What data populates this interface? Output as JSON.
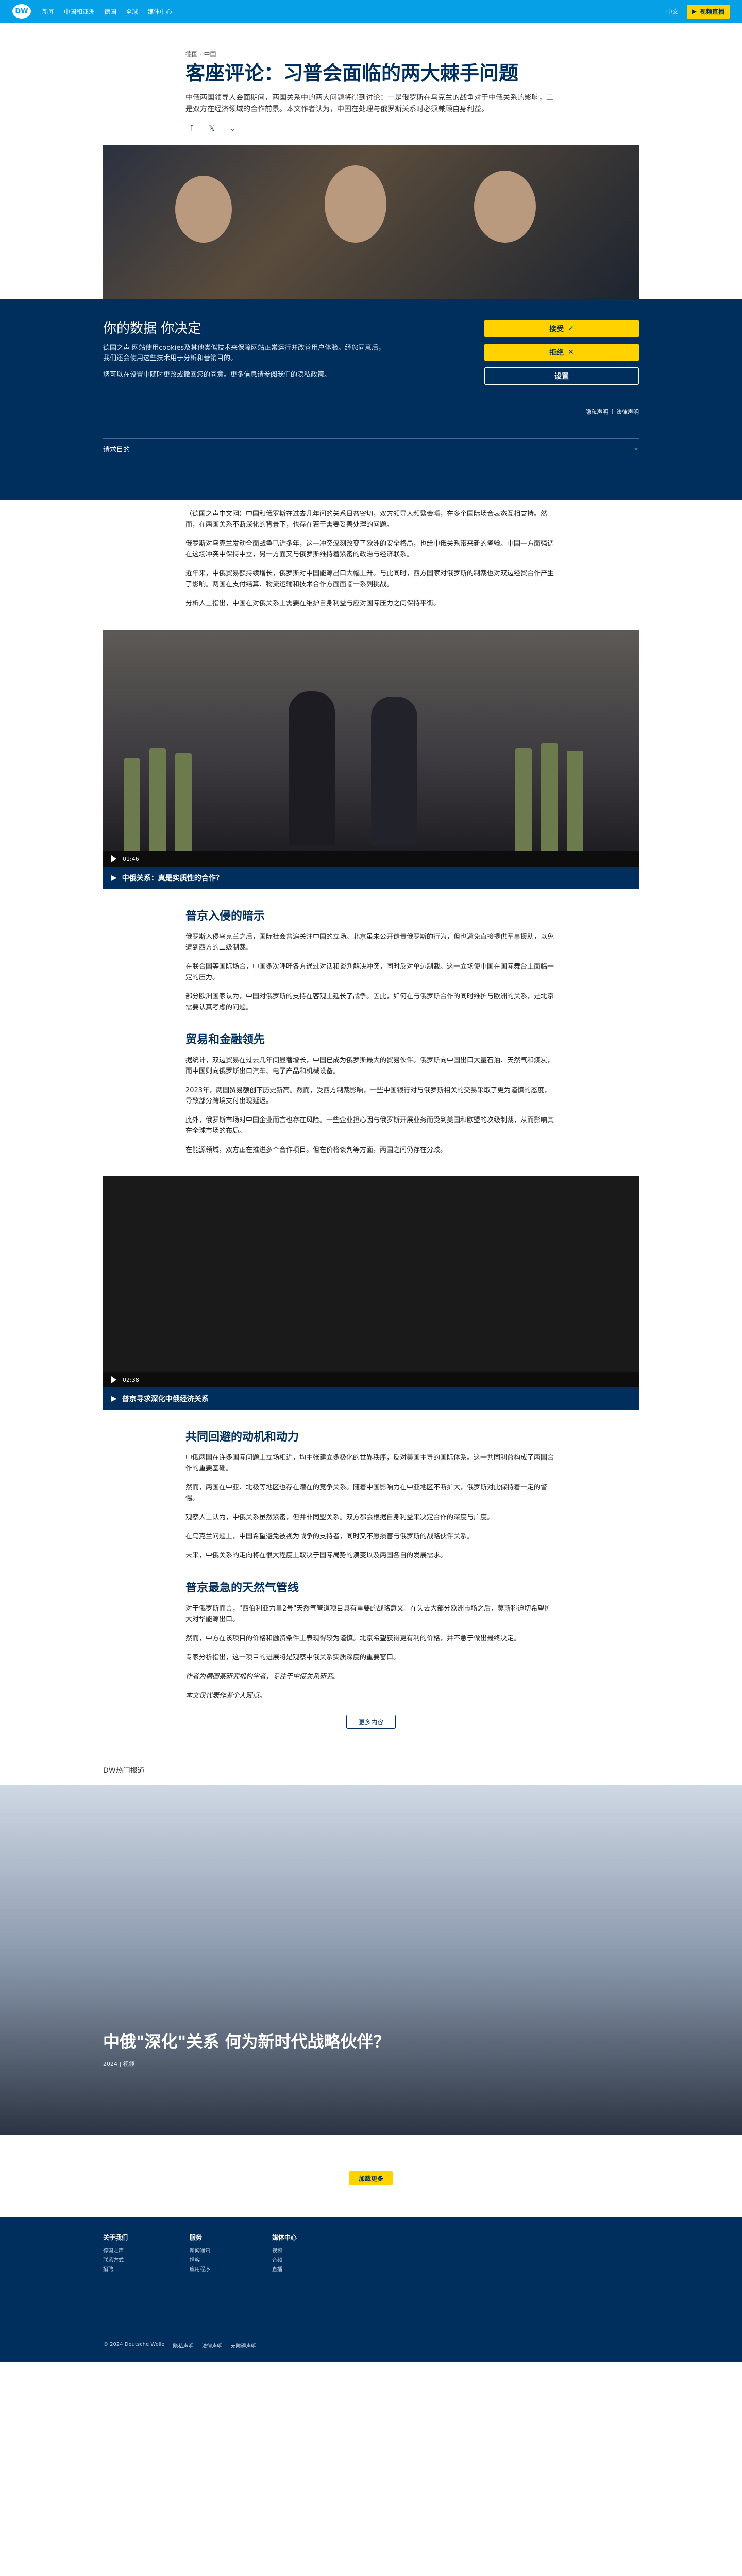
{
  "topbar": {
    "nav": [
      "DW",
      "新闻",
      "中国和亚洲",
      "德国",
      "全球",
      "媒体中心"
    ],
    "lang": "中文",
    "media_btn": "视频直播"
  },
  "article": {
    "kicker": "德国 · 中国",
    "title": "客座评论：习普会面临的两大棘手问题",
    "lead": "中俄两国领导人会面期间，两国关系中的两大问题将得到讨论：一是俄罗斯在乌克兰的战争对于中俄关系的影响，二是双方在经济领域的合作前景。本文作者认为，中国在处理与俄罗斯关系时必须兼顾自身利益。"
  },
  "consent": {
    "title": "你的数据 你决定",
    "text1": "德国之声 网站使用cookies及其他类似技术来保障网站正常运行并改善用户体验。经您同意后，我们还会使用这些技术用于分析和营销目的。",
    "text2": "您可以在设置中随时更改或撤回您的同意。更多信息请参阅我们的隐私政策。",
    "accept": "接受",
    "reject": "拒绝",
    "settings": "设置",
    "links": [
      "隐私声明",
      "法律声明"
    ],
    "more": "请求目的"
  },
  "body": {
    "p1": "（德国之声中文网）中国和俄罗斯在过去几年间的关系日益密切，双方领导人频繁会晤，在多个国际场合表态互相支持。然而，在两国关系不断深化的背景下，也存在若干需要妥善处理的问题。",
    "p2": "俄罗斯对乌克兰发动全面战争已近多年，这一冲突深刻改变了欧洲的安全格局，也给中俄关系带来新的考验。中国一方面强调在这场冲突中保持中立，另一方面又与俄罗斯维持着紧密的政治与经济联系。",
    "p3": "近年来，中俄贸易额持续增长，俄罗斯对中国能源出口大幅上升。与此同时，西方国家对俄罗斯的制裁也对双边经贸合作产生了影响。两国在支付结算、物流运输和技术合作方面面临一系列挑战。",
    "p4": "分析人士指出，中国在对俄关系上需要在维护自身利益与应对国际压力之间保持平衡。"
  },
  "video1": {
    "time": "01:46",
    "caption": "中俄关系：真是实质性的合作？"
  },
  "sec1": {
    "title": "普京入侵的暗示",
    "p1": "俄罗斯入侵乌克兰之后，国际社会普遍关注中国的立场。北京虽未公开谴责俄罗斯的行为，但也避免直接提供军事援助，以免遭到西方的二级制裁。",
    "p2": "在联合国等国际场合，中国多次呼吁各方通过对话和谈判解决冲突，同时反对单边制裁。这一立场使中国在国际舞台上面临一定的压力。",
    "p3": "部分欧洲国家认为，中国对俄罗斯的支持在客观上延长了战争。因此，如何在与俄罗斯合作的同时维护与欧洲的关系，是北京需要认真考虑的问题。"
  },
  "sec2": {
    "title": "贸易和金融领先",
    "p1": "据统计，双边贸易在过去几年间显著增长，中国已成为俄罗斯最大的贸易伙伴。俄罗斯向中国出口大量石油、天然气和煤炭，而中国则向俄罗斯出口汽车、电子产品和机械设备。",
    "p2": "2023年，两国贸易额创下历史新高。然而，受西方制裁影响，一些中国银行对与俄罗斯相关的交易采取了更为谨慎的态度，导致部分跨境支付出现延迟。",
    "p3": "此外，俄罗斯市场对中国企业而言也存在风险。一些企业担心因与俄罗斯开展业务而受到美国和欧盟的次级制裁，从而影响其在全球市场的布局。",
    "p4": "在能源领域，双方正在推进多个合作项目。但在价格谈判等方面，两国之间仍存在分歧。"
  },
  "video2": {
    "time": "02:38",
    "caption": "普京寻求深化中俄经济关系"
  },
  "sec3": {
    "title": "共同回避的动机和动力",
    "p1": "中俄两国在许多国际问题上立场相近，均主张建立多极化的世界秩序，反对美国主导的国际体系。这一共同利益构成了两国合作的重要基础。",
    "p2": "然而，两国在中亚、北极等地区也存在潜在的竞争关系。随着中国影响力在中亚地区不断扩大，俄罗斯对此保持着一定的警惕。",
    "p3": "观察人士认为，中俄关系虽然紧密，但并非同盟关系。双方都会根据自身利益来决定合作的深度与广度。",
    "p4": "在乌克兰问题上，中国希望避免被视为战争的支持者，同时又不愿损害与俄罗斯的战略伙伴关系。",
    "p5": "未来，中俄关系的走向将在很大程度上取决于国际局势的演变以及两国各自的发展需求。"
  },
  "sec4": {
    "title": "普京最急的天然气管线",
    "p1": "对于俄罗斯而言，\"西伯利亚力量2号\"天然气管道项目具有重要的战略意义。在失去大部分欧洲市场之后，莫斯科迫切希望扩大对华能源出口。",
    "p2": "然而，中方在该项目的价格和融资条件上表现得较为谨慎。北京希望获得更有利的价格，并不急于做出最终决定。",
    "p3": "专家分析指出，这一项目的进展将是观察中俄关系实质深度的重要窗口。",
    "p4": "作者为德国某研究机构学者，专注于中俄关系研究。",
    "note": "本文仅代表作者个人观点。"
  },
  "more_btn": "更多内容",
  "related": {
    "header": "DW热门报道",
    "title": "中俄\"深化\"关系 何为新时代战略伙伴？",
    "meta": "2024 | 视频"
  },
  "load_more": "加载更多",
  "footer": {
    "cols": [
      {
        "title": "关于我们",
        "items": [
          "德国之声",
          "联系方式",
          "招聘"
        ]
      },
      {
        "title": "服务",
        "items": [
          "新闻通讯",
          "播客",
          "应用程序"
        ]
      },
      {
        "title": "媒体中心",
        "items": [
          "视频",
          "音频",
          "直播"
        ]
      }
    ],
    "bottom": [
      "© 2024 Deutsche Welle",
      "隐私声明",
      "法律声明",
      "无障碍声明"
    ]
  }
}
